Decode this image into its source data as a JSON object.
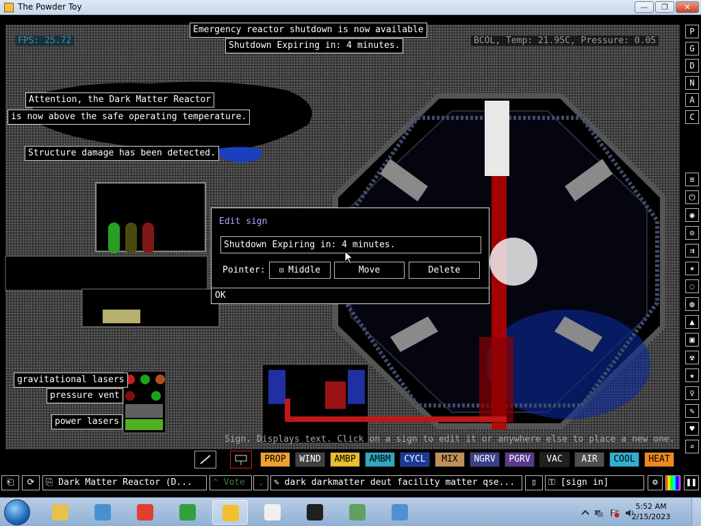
{
  "window": {
    "title": "The Powder Toy",
    "minimize": "—",
    "maximize": "❐",
    "close": "✕"
  },
  "hud": {
    "fps": "FPS: 25.72",
    "status": "BCOL, Temp: 21.95C, Pressure: 0.05"
  },
  "signs": {
    "emergency": "Emergency reactor shutdown is now available",
    "shutdown_expiring": "Shutdown Expiring in: 4 minutes.",
    "attention_1": "Attention, the Dark Matter Reactor",
    "attention_2": "is now above the safe operating temperature.",
    "structure": "Structure damage has been detected.",
    "grav_lasers": "gravitational lasers",
    "pressure_vent": "pressure vent",
    "power_lasers": "power lasers"
  },
  "dialog": {
    "title": "Edit sign",
    "input_value": "Shutdown Expiring in: 4 minutes.",
    "pointer_label": "Pointer:",
    "pointer_value": "Middle",
    "move_label": "Move",
    "delete_label": "Delete",
    "ok_label": "OK"
  },
  "tool_hint": "Sign. Displays text. Click on a sign to edit it or anywhere else to place a new one.",
  "right_menu_top": [
    "P",
    "G",
    "D",
    "N",
    "A",
    "C"
  ],
  "right_menu_icons": [
    {
      "icon": "walls-icon"
    },
    {
      "icon": "electronics-icon"
    },
    {
      "icon": "powered-icon"
    },
    {
      "icon": "sensors-icon"
    },
    {
      "icon": "force-icon"
    },
    {
      "icon": "explosives-icon"
    },
    {
      "icon": "gases-icon"
    },
    {
      "icon": "liquids-icon"
    },
    {
      "icon": "powders-icon"
    },
    {
      "icon": "solids-icon"
    },
    {
      "icon": "radioactive-icon"
    },
    {
      "icon": "special-icon"
    },
    {
      "icon": "life-icon"
    },
    {
      "icon": "tools-icon"
    },
    {
      "icon": "favorites-icon"
    },
    {
      "icon": "search-icon"
    }
  ],
  "elements": [
    {
      "label": "PROP",
      "bg": "#f0a030",
      "fg": "#000"
    },
    {
      "label": "WIND",
      "bg": "#404040",
      "fg": "#fff"
    },
    {
      "label": "AMBP",
      "bg": "#e8c030",
      "fg": "#000"
    },
    {
      "label": "AMBM",
      "bg": "#30a8c0",
      "fg": "#000"
    },
    {
      "label": "CYCL",
      "bg": "#1a3a9a",
      "fg": "#fff"
    },
    {
      "label": "MIX",
      "bg": "#c09058",
      "fg": "#000"
    },
    {
      "label": "NGRV",
      "bg": "#3a3f8a",
      "fg": "#fff"
    },
    {
      "label": "PGRV",
      "bg": "#5a3a8a",
      "fg": "#fff"
    },
    {
      "label": "VAC",
      "bg": "#202020",
      "fg": "#fff"
    },
    {
      "label": "AIR",
      "bg": "#505050",
      "fg": "#fff"
    },
    {
      "label": "COOL",
      "bg": "#30b0d0",
      "fg": "#000"
    },
    {
      "label": "HEAT",
      "bg": "#f08a20",
      "fg": "#000"
    }
  ],
  "bottombar": {
    "save_name": "Dark Matter Reactor (D...",
    "vote": "Vote",
    "tags": "dark darkmatter deut facility matter qse...",
    "sign_in": "[sign in]"
  },
  "taskbar": {
    "time": "5:52 AM",
    "date": "2/15/2023",
    "items": [
      "explorer",
      "media-player",
      "chrome",
      "csharp-app",
      "powder-toy",
      "7zip",
      "cmd",
      "monitor-app",
      "control-panel"
    ]
  },
  "colors": {
    "dialog_title": "#a8a8ff",
    "laser_red": "#e02020",
    "sim_bg": "#3a3a3a"
  }
}
